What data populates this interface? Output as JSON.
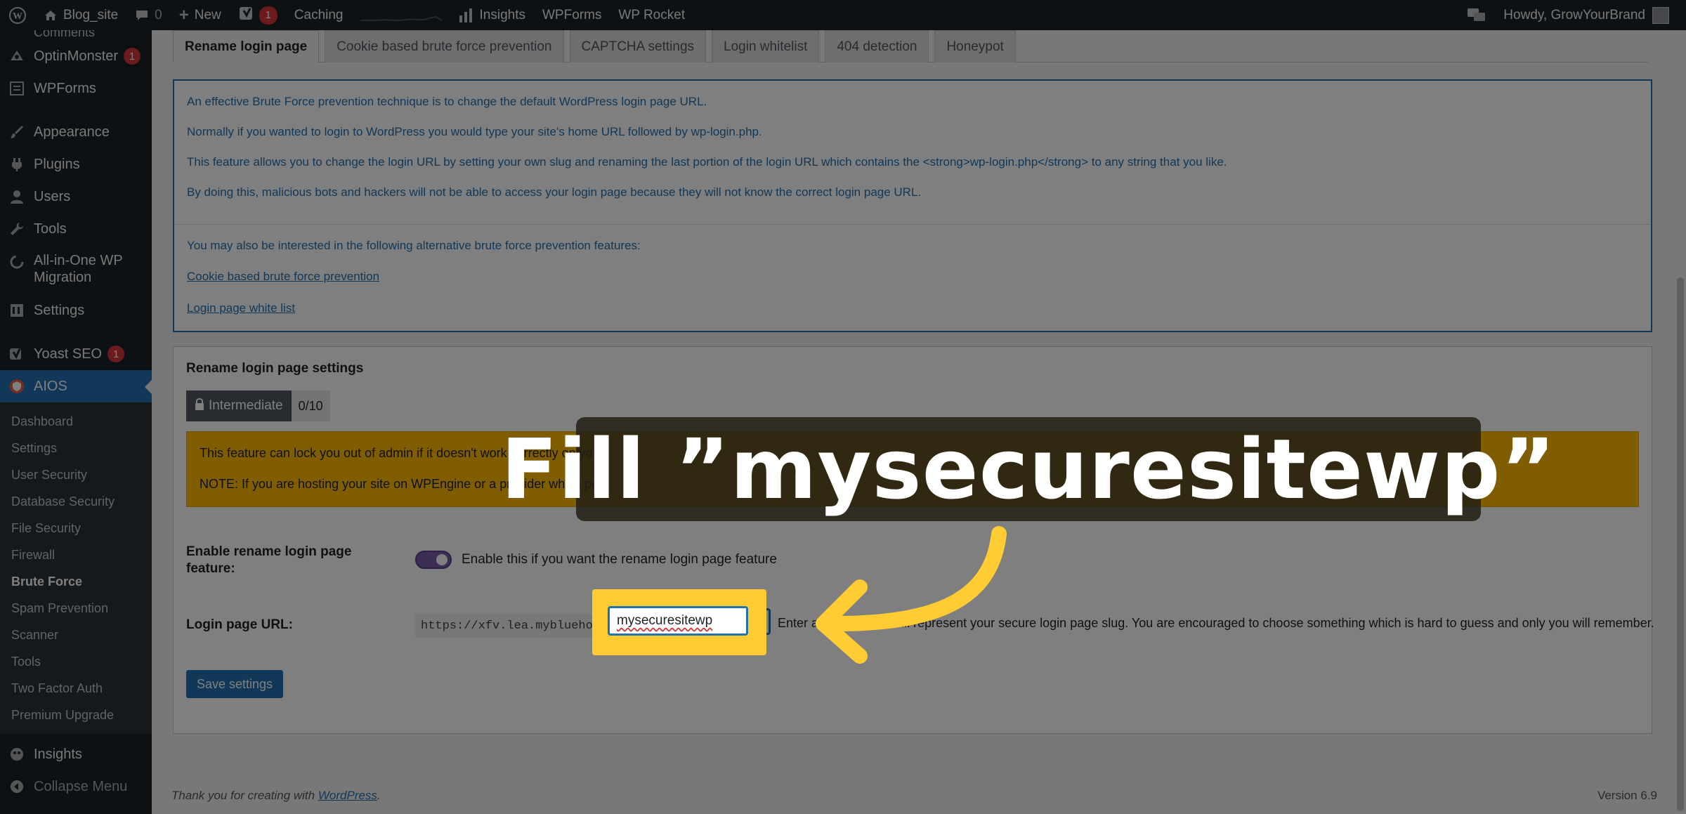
{
  "adminbar": {
    "site_name": "Blog_site",
    "comments_count": "0",
    "new_label": "New",
    "yoast_count": "1",
    "caching_label": "Caching",
    "insights_label": "Insights",
    "wpforms_label": "WPForms",
    "wprocket_label": "WP Rocket",
    "howdy": "Howdy, GrowYourBrand"
  },
  "sidebar": {
    "partial_item": "Comments",
    "items": [
      {
        "label": "OptinMonster",
        "badge": "1",
        "icon": "optinmonster-icon"
      },
      {
        "label": "WPForms",
        "icon": "wpforms-icon"
      },
      {
        "label": "Appearance",
        "icon": "paintbrush-icon"
      },
      {
        "label": "Plugins",
        "icon": "plugin-icon"
      },
      {
        "label": "Users",
        "icon": "user-icon"
      },
      {
        "label": "Tools",
        "icon": "wrench-icon"
      },
      {
        "label": "All-in-One WP Migration",
        "icon": "migration-icon"
      },
      {
        "label": "Settings",
        "icon": "settings-icon"
      },
      {
        "label": "Yoast SEO",
        "badge": "1",
        "icon": "yoast-icon"
      },
      {
        "label": "AIOS",
        "icon": "aios-icon"
      }
    ],
    "submenu": [
      "Dashboard",
      "Settings",
      "User Security",
      "Database Security",
      "File Security",
      "Firewall",
      "Brute Force",
      "Spam Prevention",
      "Scanner",
      "Tools",
      "Two Factor Auth",
      "Premium Upgrade"
    ],
    "insights": "Insights",
    "collapse": "Collapse Menu"
  },
  "tabs": [
    "Rename login page",
    "Cookie based brute force prevention",
    "CAPTCHA settings",
    "Login whitelist",
    "404 detection",
    "Honeypot"
  ],
  "info": {
    "p1": "An effective Brute Force prevention technique is to change the default WordPress login page URL.",
    "p2": "Normally if you wanted to login to WordPress you would type your site's home URL followed by wp-login.php.",
    "p3": "This feature allows you to change the login URL by setting your own slug and renaming the last portion of the login URL which contains the <strong>wp-login.php</strong> to any string that you like.",
    "p4": "By doing this, malicious bots and hackers will not be able to access your login page because they will not know the correct login page URL.",
    "p5": "You may also be interested in the following alternative brute force prevention features:",
    "link1": "Cookie based brute force prevention",
    "link2": "Login page white list"
  },
  "settings": {
    "title": "Rename login page settings",
    "level": "Intermediate",
    "score": "0/10",
    "warning1": "This feature can lock you out of admin if it doesn't work correctly on yo",
    "warning2": "NOTE: If you are hosting your site on WPEngine or a provider which pe",
    "enable_label": "Enable rename login page feature:",
    "enable_help": "Enable this if you want the rename login page feature",
    "enable_on": true,
    "url_label": "Login page URL:",
    "url_prefix": "https://xfv.lea.mybluehost.me/",
    "slug_value": "mysecuresitewp",
    "url_help": "Enter a string which will represent your secure login page slug. You are encouraged to choose something which is hard to guess and only you will remember.",
    "save_label": "Save settings"
  },
  "footer": {
    "thanks": "Thank you for creating with ",
    "wp_link": "WordPress",
    "period": ".",
    "version": "Version 6.9"
  },
  "annotation": {
    "text": "Fill ”mysecuresitewp”",
    "typed": "mysecuresitewp"
  },
  "colors": {
    "highlight": "#ffcc33",
    "accent": "#2271b1",
    "warning": "#ffba00"
  }
}
